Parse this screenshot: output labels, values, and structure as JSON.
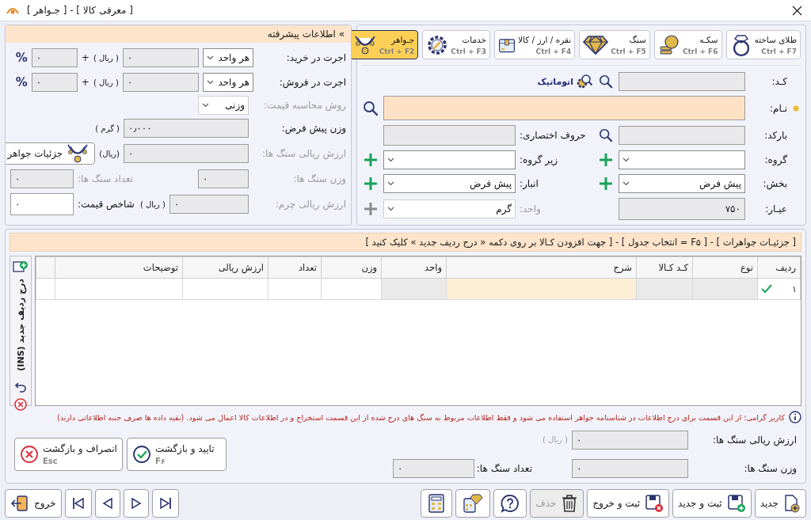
{
  "window": {
    "title": "[ معرفی کالا ] - [ جـواهر ]"
  },
  "categories": [
    {
      "label": "طلای ساخته",
      "shortcut": "Ctrl + F7",
      "selected": false
    },
    {
      "label": "سکـه",
      "shortcut": "Ctrl + F6",
      "selected": false
    },
    {
      "label": "سنگ",
      "shortcut": "Ctrl + F5",
      "selected": false
    },
    {
      "label": "نقره / ارز / کالا",
      "shortcut": "Ctrl + F4",
      "selected": false
    },
    {
      "label": "خدمات",
      "shortcut": "Ctrl + F3",
      "selected": false
    },
    {
      "label": "جـواهر",
      "shortcut": "Ctrl + F2",
      "selected": true
    }
  ],
  "main_form": {
    "code": {
      "label": "کـد:",
      "auto_button": "اتوماتیک"
    },
    "name": {
      "label": "نـام:",
      "required": true
    },
    "barcode": {
      "label": "بارکد:"
    },
    "abbreviation": {
      "label": "حروف اختصاری:"
    },
    "group": {
      "label": "گروه:"
    },
    "subgroup": {
      "label": "زیر گروه:"
    },
    "section": {
      "label": "بخش:",
      "value": "پیش فرض"
    },
    "warehouse": {
      "label": "انبار:",
      "value": "پیش فرض"
    },
    "karat": {
      "label": "عیـار:",
      "value": "۷۵۰"
    },
    "unit": {
      "label": "واحد:",
      "value": "گرم",
      "disabled": true
    }
  },
  "advanced": {
    "title": "» اطلاعات پیشرفته",
    "purchase_fee": {
      "label": "اجرت در خرید:",
      "mode": "هر واحد",
      "amount": "۰",
      "currency": "( ریال )",
      "plus": "+",
      "percent_value": "۰",
      "percent": "%"
    },
    "sale_fee": {
      "label": "اجرت در فروش:",
      "mode": "هر واحد",
      "amount": "۰",
      "currency": "( ریال )",
      "plus": "+",
      "percent_value": "۰",
      "percent": "%"
    },
    "price_method": {
      "label": "روش محاسبه قیمت:",
      "value": "وزنی",
      "disabled": true
    },
    "default_weight": {
      "label": "وزن پیش فرض:",
      "value": "۰٫۰۰۰",
      "unit": "( گرم )",
      "disabled": false
    },
    "stones_value": {
      "label": "ارزش ریالی سنگ ها:",
      "value": "۰",
      "unit": "(ریال)",
      "disabled": true
    },
    "details_button": "جزئیات جواهر",
    "stones_weight": {
      "label": "وزن سنگ ها:",
      "value": "۰",
      "disabled": true
    },
    "stones_count": {
      "label": "تعداد سنگ ها:",
      "value": "۰",
      "disabled": true
    },
    "leather_value": {
      "label": "ارزش ریالی چرم:",
      "value": "۰",
      "unit": "( ریال )",
      "disabled": true
    },
    "price_index": {
      "label": "شاخص قیمت:",
      "value": "۰",
      "disabled": false
    }
  },
  "details": {
    "header": "[ جزئیـات جواهرات  ] - [ F۵ = انتخاب جدول ] - [ جهت افزودن کـالا بر روی دکمه « درج ردیف جدید » کلیک کنید ]",
    "side_button": "درج ردیف جدید (INS)",
    "columns": [
      {
        "label": "ردیف",
        "readonly": false,
        "focused": false
      },
      {
        "label": "نوع",
        "readonly": true,
        "focused": false
      },
      {
        "label": "کـد کـالا",
        "readonly": true,
        "focused": false
      },
      {
        "label": "شرح",
        "readonly": false,
        "focused": true
      },
      {
        "label": "واحد",
        "readonly": true,
        "focused": false
      },
      {
        "label": "وزن",
        "readonly": false,
        "focused": false
      },
      {
        "label": "تعداد",
        "readonly": false,
        "focused": false
      },
      {
        "label": "ارزش ریالی",
        "readonly": false,
        "focused": false
      },
      {
        "label": "توضیحات",
        "readonly": false,
        "focused": false
      }
    ],
    "rows": [
      {
        "number": "۱",
        "confirmed": true
      }
    ],
    "note": "کاربر گرامی؛ از این قسمت برای درج اطلاعات در شناسنامه جواهر استفاده می شود و فقط اطلاعات مربوط به سنگ های درج شده از این قسمت استخراج و در اطلاعات کالا اعمال می شود. (بقیه داده ها صرف جنبه اطلاعاتی دارند)",
    "stones_value": {
      "label": "ارزش ریالی سنگ ها:",
      "value": "۰",
      "unit": "( ریال )"
    },
    "stones_weight": {
      "label": "وزن سنگ ها:",
      "value": "۰"
    },
    "stones_count": {
      "label": "تعداد سنگ ها:",
      "value": "۰"
    },
    "confirm_button": {
      "label": "تایید و بازگشت",
      "shortcut": "F۶"
    },
    "cancel_button": {
      "label": "انصراف و بازگشت",
      "shortcut": "Esc"
    }
  },
  "toolbar": [
    {
      "kind": "new",
      "label": "جدید",
      "disabled": false
    },
    {
      "kind": "save_new",
      "label": "ثبت و جدید",
      "disabled": false
    },
    {
      "kind": "save_exit",
      "label": "ثبت و خروج",
      "disabled": false
    },
    {
      "kind": "delete",
      "label": "حذف",
      "disabled": true
    },
    {
      "kind": "help",
      "disabled": false
    },
    {
      "kind": "jewel_calc",
      "disabled": false
    },
    {
      "kind": "calculator",
      "disabled": false
    },
    {
      "kind": "last",
      "disabled": false
    },
    {
      "kind": "next",
      "disabled": false
    },
    {
      "kind": "prev",
      "disabled": false
    },
    {
      "kind": "first",
      "disabled": false
    },
    {
      "kind": "exit",
      "label": "خروج",
      "disabled": false
    }
  ]
}
